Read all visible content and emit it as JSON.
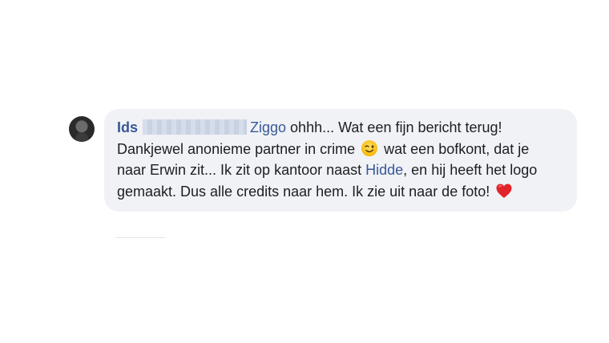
{
  "comment": {
    "author": "Ids",
    "mention_company": "Ziggo",
    "text_part1": " ohhh... Wat een fijn bericht terug! Dankjewel anonieme partner in crime ",
    "emoji_wink": "winking-face-icon",
    "text_part2": " wat een bofkont, dat je naar Erwin zit... Ik zit op kantoor naast ",
    "mention_person": "Hidde",
    "text_part3": ", en hij heeft het logo gemaakt. Dus alle credits naar hem. Ik zie uit naar de foto! ",
    "emoji_heart": "red-heart-icon"
  },
  "colors": {
    "bubble_bg": "#f0f2f5",
    "link": "#385898",
    "text": "#1c1e21",
    "redaction": "#c9d2e3"
  }
}
